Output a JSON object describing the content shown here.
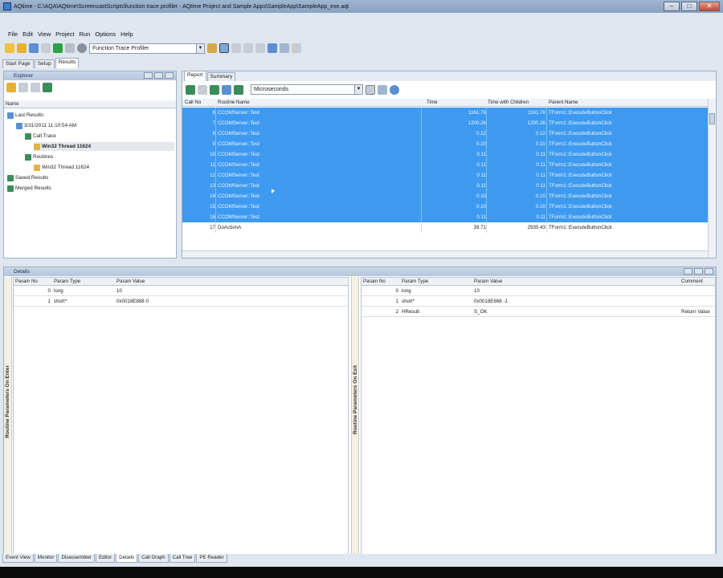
{
  "window": {
    "title": "AQtime - C:\\AQA\\AQtime\\ScreencastScripts\\function trace profiler - AQtime Project and Sample Apps\\SampleApp\\SampleApp_exe.aqt"
  },
  "menu": [
    "File",
    "Edit",
    "View",
    "Project",
    "Run",
    "Options",
    "Help"
  ],
  "toolbar": {
    "profiler": "Function Trace Profiler"
  },
  "doc_tabs": [
    "Start Page",
    "Setup",
    "Results"
  ],
  "explorer": {
    "title": "Explorer",
    "column": "Name",
    "tree": [
      {
        "label": "Last Results",
        "level": 0
      },
      {
        "label": "3/31/2011 11:10:54 AM",
        "level": 1
      },
      {
        "label": "Call Trace",
        "level": 2
      },
      {
        "label": "Win32 Thread 11624",
        "level": 3,
        "selected": true
      },
      {
        "label": "Routines",
        "level": 2
      },
      {
        "label": "Win32 Thread 11624",
        "level": 3
      },
      {
        "label": "Saved Results",
        "level": 0
      },
      {
        "label": "Merged Results",
        "level": 0
      }
    ]
  },
  "report": {
    "tabs": [
      "Report",
      "Summary"
    ],
    "units": "Microseconds",
    "columns": [
      "Call No",
      "Routine Name",
      "Time",
      "Time with Children",
      "Parent Name"
    ],
    "rows": [
      {
        "call": "6",
        "routine": "CCOMServer::Test",
        "time": "1161.78",
        "twc": "1161.78",
        "parent": "TForm1::ExecuteButtonClick",
        "sel": true
      },
      {
        "call": "7",
        "routine": "CCOMServer::Test",
        "time": "1200.26",
        "twc": "1200.26",
        "parent": "TForm1::ExecuteButtonClick",
        "sel": true
      },
      {
        "call": "8",
        "routine": "CCOMServer::Test",
        "time": "0.12",
        "twc": "0.12",
        "parent": "TForm1::ExecuteButtonClick",
        "sel": true
      },
      {
        "call": "9",
        "routine": "CCOMServer::Test",
        "time": "0.10",
        "twc": "0.10",
        "parent": "TForm1::ExecuteButtonClick",
        "sel": true
      },
      {
        "call": "10",
        "routine": "CCOMServer::Test",
        "time": "0.11",
        "twc": "0.11",
        "parent": "TForm1::ExecuteButtonClick",
        "sel": true
      },
      {
        "call": "11",
        "routine": "CCOMServer::Test",
        "time": "0.11",
        "twc": "0.11",
        "parent": "TForm1::ExecuteButtonClick",
        "sel": true
      },
      {
        "call": "12",
        "routine": "CCOMServer::Test",
        "time": "0.11",
        "twc": "0.11",
        "parent": "TForm1::ExecuteButtonClick",
        "sel": true
      },
      {
        "call": "13",
        "routine": "CCOMServer::Test",
        "time": "0.11",
        "twc": "0.11",
        "parent": "TForm1::ExecuteButtonClick",
        "sel": true
      },
      {
        "call": "14",
        "routine": "CCOMServer::Test",
        "time": "0.10",
        "twc": "0.10",
        "parent": "TForm1::ExecuteButtonClick",
        "sel": true
      },
      {
        "call": "15",
        "routine": "CCOMServer::Test",
        "time": "0.10",
        "twc": "0.10",
        "parent": "TForm1::ExecuteButtonClick",
        "sel": true
      },
      {
        "call": "16",
        "routine": "CCOMServer::Test",
        "time": "0.11",
        "twc": "0.11",
        "parent": "TForm1::ExecuteButtonClick",
        "sel": true
      },
      {
        "call": "17",
        "routine": "DoActionA",
        "time": "39.71",
        "twc": "2935.43",
        "parent": "TForm1::ExecuteButtonClick",
        "sel": false
      }
    ]
  },
  "details": {
    "title": "Details",
    "left": {
      "label": "Routine Parameters On Enter",
      "columns": [
        "Param No",
        "Param Type",
        "Param Value"
      ],
      "rows": [
        {
          "no": "0",
          "type": "long",
          "value": "10"
        },
        {
          "no": "1",
          "type": "short*",
          "value": "0x0018E868 0"
        }
      ]
    },
    "right": {
      "label": "Routine Parameters On Exit",
      "columns": [
        "Param No",
        "Param Type",
        "Param Value",
        "Comment"
      ],
      "rows": [
        {
          "no": "0",
          "type": "long",
          "value": "10",
          "comment": ""
        },
        {
          "no": "1",
          "type": "short*",
          "value": "0x0018E868 -1",
          "comment": ""
        },
        {
          "no": "2",
          "type": "HResult",
          "value": "S_OK",
          "comment": "Return Value"
        }
      ]
    }
  },
  "bottom_tabs": [
    "Event View",
    "Monitor",
    "Disassembler",
    "Editor",
    "Details",
    "Call Graph",
    "Call Tree",
    "PE Reader"
  ],
  "colors": {
    "selection": "#3d9af0",
    "header": "#b4c6dc"
  }
}
